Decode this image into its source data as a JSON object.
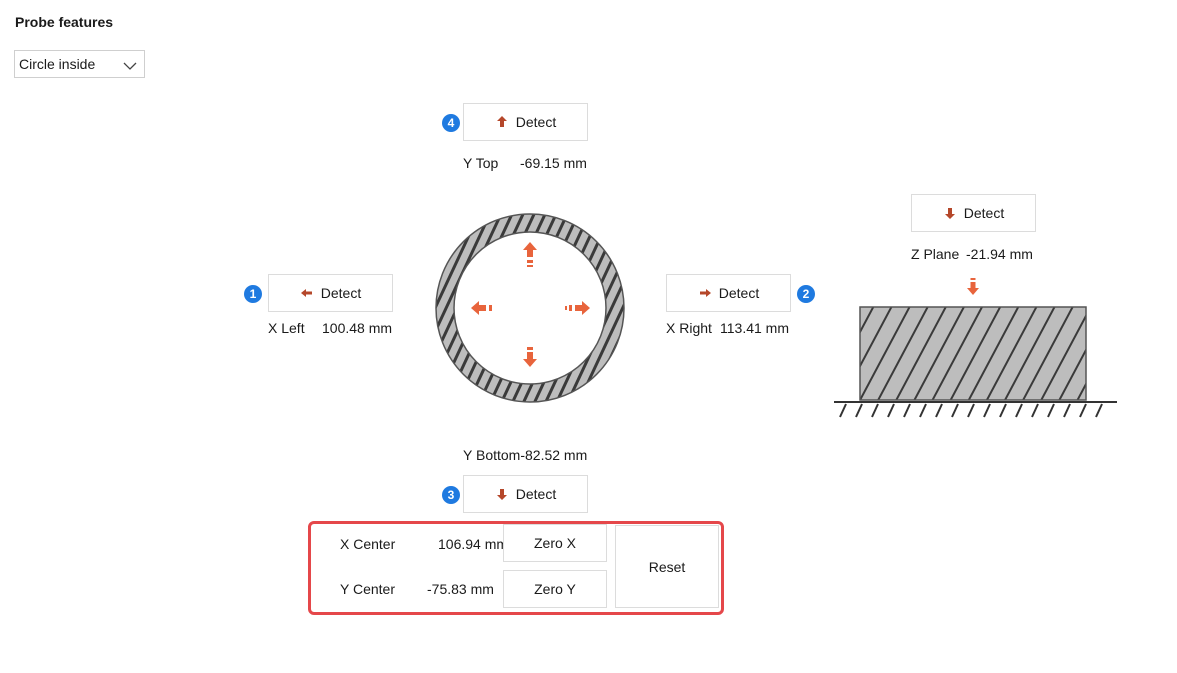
{
  "title": "Probe features",
  "feature_select": {
    "value": "Circle inside"
  },
  "detect_label": "Detect",
  "y_top": {
    "badge": "4",
    "label": "Y Top",
    "value": "-69.15 mm"
  },
  "x_left": {
    "badge": "1",
    "label": "X Left",
    "value": "100.48 mm"
  },
  "x_right": {
    "badge": "2",
    "label": "X Right",
    "value": "113.41 mm"
  },
  "y_bottom": {
    "badge": "3",
    "label": "Y Bottom",
    "value": "-82.52 mm"
  },
  "z_plane": {
    "label": "Z Plane",
    "value": "-21.94 mm"
  },
  "center": {
    "x_label": "X Center",
    "x_value": "106.94 mm",
    "zero_x": "Zero X",
    "y_label": "Y Center",
    "y_value": "-75.83 mm",
    "zero_y": "Zero Y",
    "reset": "Reset"
  },
  "colors": {
    "arrow": "#e8643c",
    "arrow_dark": "#b5472a",
    "badge": "#1f7ae0",
    "highlight": "#e5474a"
  }
}
